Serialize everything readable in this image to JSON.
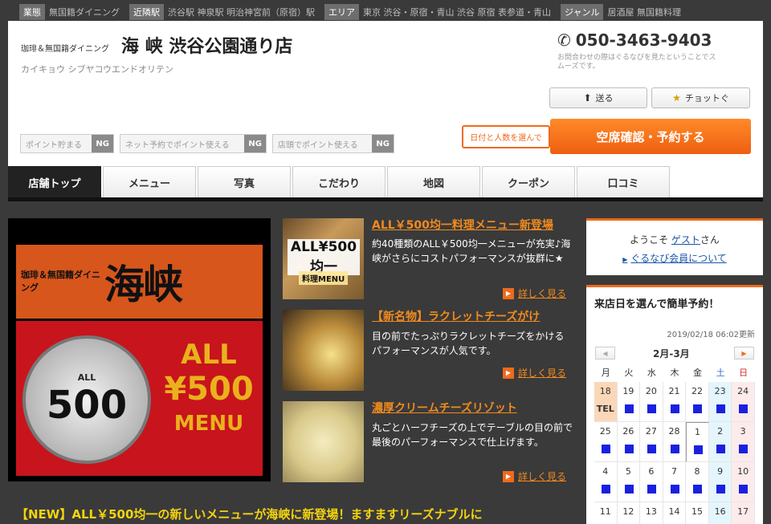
{
  "meta": {
    "business_type_label": "業態",
    "business_type": "無国籍ダイニング",
    "station_label": "近隣駅",
    "station": "渋谷駅 神泉駅 明治神宮前（原宿）駅",
    "area_label": "エリア",
    "area": "東京 渋谷・原宿・青山 渋谷 原宿 表参道・青山",
    "genre_label": "ジャンル",
    "genre": "居酒屋 無国籍料理"
  },
  "shop": {
    "subtitle": "珈琲＆無国籍ダイニング",
    "name": "海 峡 渋谷公園通り店",
    "kana": "カイキョウ シブヤコウエンドオリテン",
    "phone": "050-3463-9403",
    "phone_note": "お問合わせの際はぐるなびを見たということでスムーズです。"
  },
  "actions": {
    "send": "送る",
    "check": "チョットぐ",
    "date_hint": "日付と人数を選んで",
    "reserve": "空席確認・予約する"
  },
  "points": [
    {
      "label": "ポイント貯まる",
      "status": "NG"
    },
    {
      "label": "ネット予約でポイント使える",
      "status": "NG"
    },
    {
      "label": "店頭でポイント使える",
      "status": "NG"
    }
  ],
  "tabs": [
    "店舗トップ",
    "メニュー",
    "写真",
    "こだわり",
    "地図",
    "クーポン",
    "口コミ"
  ],
  "hero": {
    "small_text": "珈琲＆無国籍ダイニング",
    "brand": "海峡",
    "coin_top": "ALL",
    "coin_num": "500",
    "gold1": "ALL",
    "gold2": "¥500",
    "gold3": "MENU"
  },
  "features": [
    {
      "title": "ALL￥500均一料理メニュー新登場",
      "desc": "約40種類のALL￥500均一メニューが充実♪海峡がさらにコストパフォーマンスが抜群に★",
      "more": "詳しく見る",
      "img_text": "ALL¥500均一",
      "img_menu": "料理MENU"
    },
    {
      "title": "【新名物】ラクレットチーズがけ",
      "desc": "目の前でたっぷりラクレットチーズをかけるパフォーマンスが人気です。",
      "more": "詳しく見る"
    },
    {
      "title": "濃厚クリームチーズリゾット",
      "desc": "丸ごとハーフチーズの上でテーブルの目の前で最後のパーフォーマンスで仕上げます。",
      "more": "詳しく見る"
    }
  ],
  "promo": "【NEW】ALL￥500均一の新しいメニューが海峡に新登場！ますますリーズナブルに",
  "sidebar": {
    "welcome_prefix": "ようこそ",
    "guest": "ゲスト",
    "welcome_suffix": "さん",
    "member_link": "ぐるなび会員について"
  },
  "calendar": {
    "title": "来店日を選んで簡単予約！",
    "updated": "2019/02/18 06:02更新",
    "month": "2月-3月",
    "weekdays": [
      "月",
      "火",
      "水",
      "木",
      "金",
      "土",
      "日"
    ],
    "today_label": "TEL",
    "weeks": [
      [
        "18",
        "19",
        "20",
        "21",
        "22",
        "23",
        "24"
      ],
      [
        "25",
        "26",
        "27",
        "28",
        "1",
        "2",
        "3"
      ],
      [
        "4",
        "5",
        "6",
        "7",
        "8",
        "9",
        "10"
      ],
      [
        "11",
        "12",
        "13",
        "14",
        "15",
        "16",
        "17"
      ]
    ]
  }
}
